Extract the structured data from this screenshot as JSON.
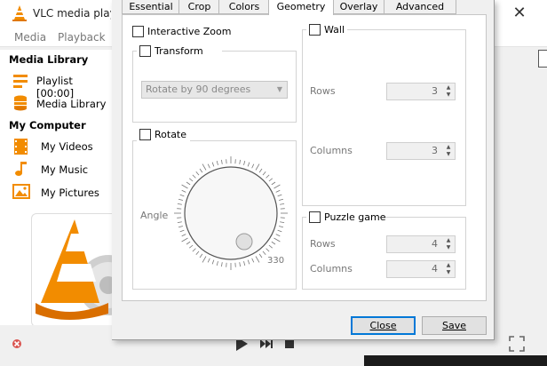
{
  "window": {
    "title": "VLC media player",
    "close_glyph": "✕"
  },
  "menu": {
    "items": [
      "Media",
      "Playback"
    ]
  },
  "sidebar": {
    "media_library_heading": "Media Library",
    "media_library_items": [
      {
        "label": "Playlist [00:00]",
        "icon": "playlist-icon"
      },
      {
        "label": "Media Library",
        "icon": "database-icon"
      }
    ],
    "my_computer_heading": "My Computer",
    "my_computer_items": [
      {
        "label": "My Videos",
        "icon": "film-icon"
      },
      {
        "label": "My Music",
        "icon": "music-note-icon"
      },
      {
        "label": "My Pictures",
        "icon": "picture-icon"
      }
    ]
  },
  "dialog": {
    "tabs": [
      "Essential",
      "Crop",
      "Colors",
      "Geometry",
      "Overlay",
      "Advanced"
    ],
    "active_tab": "Geometry",
    "interactive_zoom": {
      "label": "Interactive Zoom",
      "checked": false
    },
    "transform": {
      "label": "Transform",
      "checked": false,
      "selected": "Rotate by 90 degrees"
    },
    "rotate": {
      "label": "Rotate",
      "checked": false,
      "angle_label": "Angle",
      "value_label": "330"
    },
    "wall": {
      "label": "Wall",
      "checked": false,
      "rows_label": "Rows",
      "rows_value": "3",
      "columns_label": "Columns",
      "columns_value": "3"
    },
    "puzzle": {
      "label": "Puzzle game",
      "checked": false,
      "rows_label": "Rows",
      "rows_value": "4",
      "columns_label": "Columns",
      "columns_value": "4"
    },
    "buttons": {
      "close": "Close",
      "save": "Save"
    }
  },
  "colors": {
    "vlc_orange": "#f28c00",
    "accent_blue": "#0078d7"
  }
}
